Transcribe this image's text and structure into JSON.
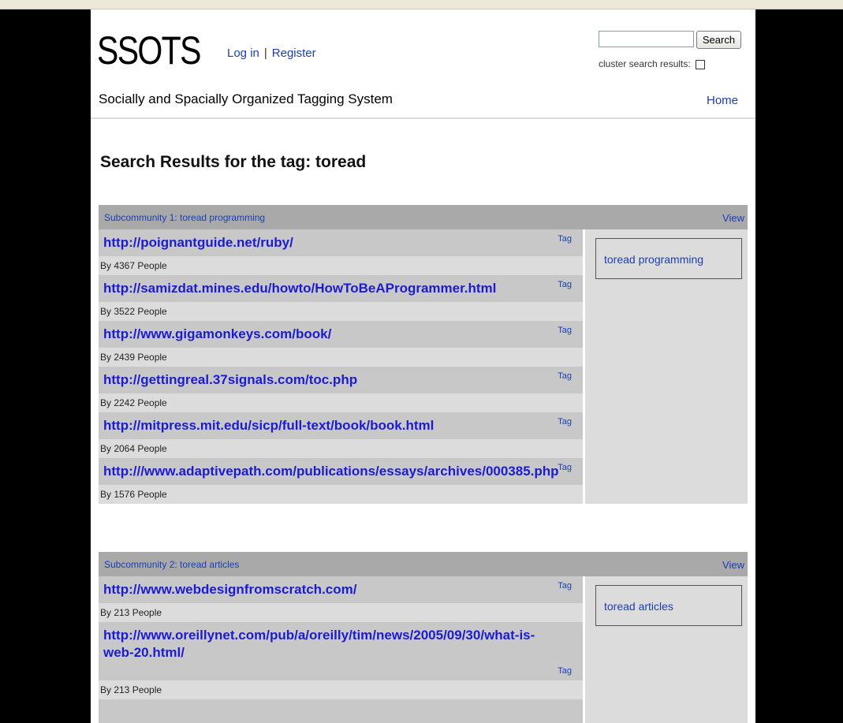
{
  "app": {
    "logo": "SSOTS",
    "login": "Log in",
    "separator": "|",
    "register": "Register",
    "subtitle": "Socially and Spacially Organized Tagging System",
    "home": "Home"
  },
  "search": {
    "button": "Search",
    "value": "",
    "cluster_label": "cluster search results:",
    "cluster_checked": false
  },
  "results": {
    "title": "Search Results for the tag: toread",
    "tag_label": "Tag",
    "view_label": "View",
    "groups": [
      {
        "title": "Subcommunity 1: toread  programming",
        "side_link": "toread programming",
        "items": [
          {
            "url": "http://poignantguide.net/ruby/",
            "by": "By 4367 People"
          },
          {
            "url": "http://samizdat.mines.edu/howto/HowToBeAProgrammer.html",
            "by": "By 3522 People"
          },
          {
            "url": "http://www.gigamonkeys.com/book/",
            "by": "By 2439 People"
          },
          {
            "url": "http://gettingreal.37signals.com/toc.php",
            "by": "By 2242 People"
          },
          {
            "url": "http://mitpress.mit.edu/sicp/full-text/book/book.html",
            "by": "By 2064 People"
          },
          {
            "url": "http:///www.adaptivepath.com/publications/essays/archives/000385.php",
            "by": "By 1576 People"
          }
        ]
      },
      {
        "title": "Subcommunity 2: toread  articles",
        "side_link": "toread articles",
        "items": [
          {
            "url": "http://www.webdesignfromscratch.com/",
            "by": "By 213 People"
          },
          {
            "url": "http://www.oreillynet.com/pub/a/oreilly/tim/news/2005/09/30/what-is-web-20.html/",
            "by": "By 213 People"
          }
        ]
      }
    ]
  }
}
